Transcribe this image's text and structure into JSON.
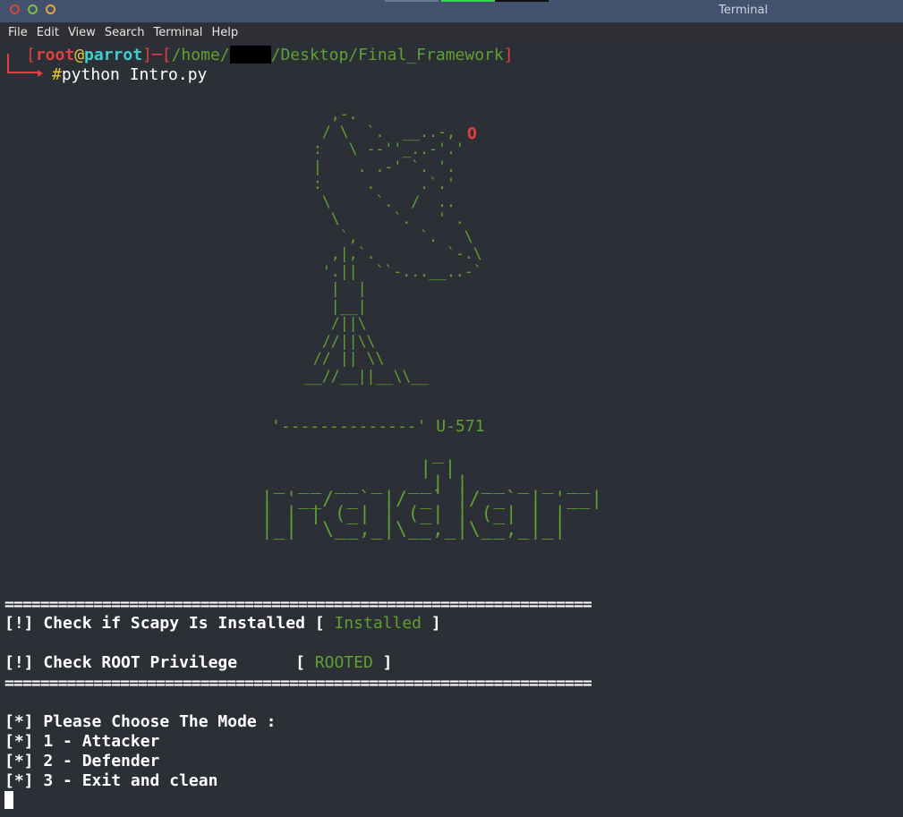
{
  "window": {
    "title": "Terminal"
  },
  "menu": [
    "File",
    "Edit",
    "View",
    "Search",
    "Terminal",
    "Help"
  ],
  "prompt": {
    "user": "root",
    "at": "@",
    "host": "parrot",
    "path_prefix": "/home/",
    "path_suffix": "/Desktop/Final_Framework",
    "symbol": "#",
    "command": "python Intro.py"
  },
  "banner": {
    "dish_tip": "O",
    "model": "U-571",
    "ascii_dish": "   ,-.\n  / \\  `.  __..-,\n :   \\ --''_..-'.'\n |    . .-' `. '.\n :     .     .`.'\n  \\     `.  /  ..\n   \\      `.   ' .\n    `,       `.   \\\n   ,|,`.        `-.\\\n  '.||  ``-...__..-`\n   |  |\n   |__|\n   /||\\\n  //||\\\\\n // || \\\\\n__//__||__\\\\__",
    "ascii_base": "'--------------'",
    "ascii_word": "              _\n             | |\n _ __ __ _  __| | __ _ _ __\n| '__/ _` |/ _` |/ _` | '__|\n| | | (_| | (_| | (_| | |\n|_|  \\__,_|\\__,_|\\__,_|_|"
  },
  "separator": "==================================================================",
  "checks": [
    {
      "label": "[!] Check if Scapy Is Installed",
      "result": "Installed"
    },
    {
      "label": "[!] Check ROOT Privilege     ",
      "result": "ROOTED"
    }
  ],
  "mode_menu": [
    "[*] Please Choose The Mode :",
    "[*] 1 - Attacker",
    "[*] 2 - Defender",
    "[*] 3 - Exit and clean"
  ],
  "colors": {
    "titlebar": "#42516e",
    "terminal_bg": "#2c3036",
    "prompt_red": "#e04040",
    "prompt_cyan": "#3ecfcf",
    "ascii_green": "#5ea033"
  }
}
